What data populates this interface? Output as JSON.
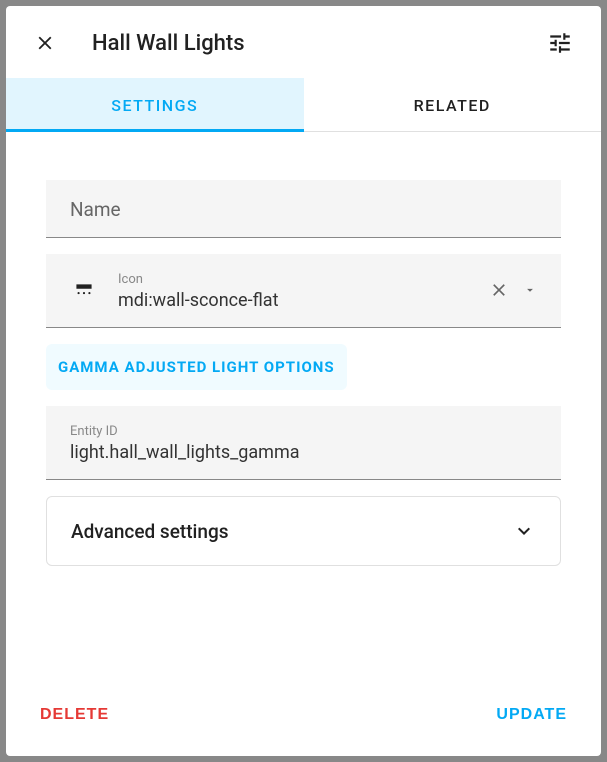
{
  "header": {
    "title": "Hall Wall Lights"
  },
  "tabs": {
    "settings": "Settings",
    "related": "Related"
  },
  "fields": {
    "name": {
      "label": "Name",
      "value": ""
    },
    "icon": {
      "label": "Icon",
      "value": "mdi:wall-sconce-flat"
    },
    "entity_id": {
      "label": "Entity ID",
      "value": "light.hall_wall_lights_gamma"
    }
  },
  "section": {
    "gamma_title": "GAMMA ADJUSTED LIGHT OPTIONS"
  },
  "advanced": {
    "title": "Advanced settings"
  },
  "actions": {
    "delete": "DELETE",
    "update": "UPDATE"
  }
}
